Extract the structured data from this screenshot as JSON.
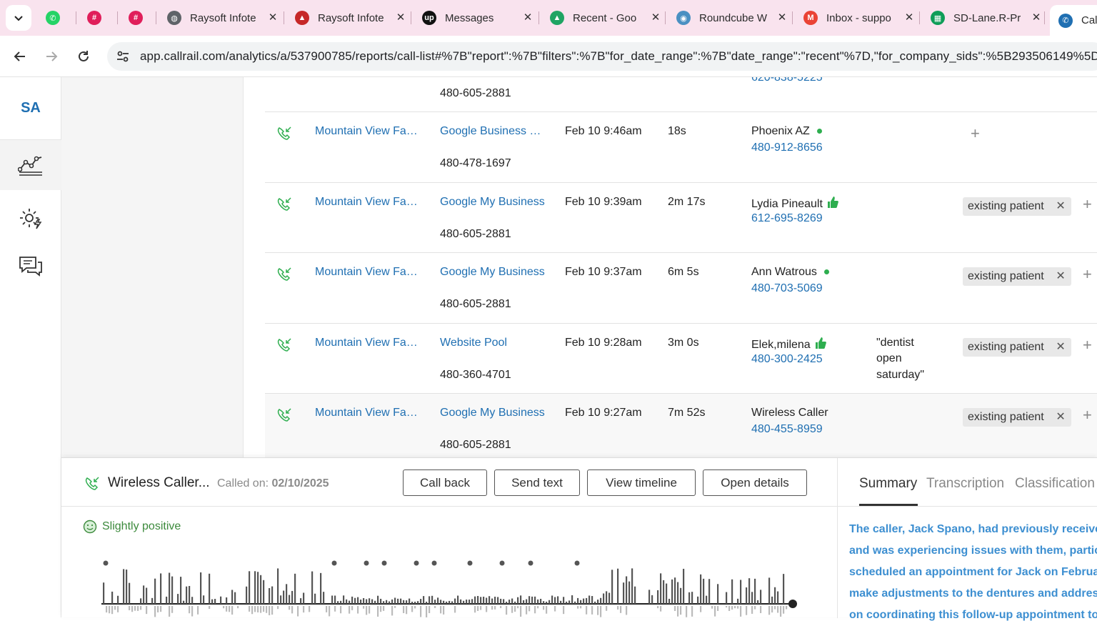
{
  "browser": {
    "tabs": [
      {
        "title": "",
        "icon": "whatsapp-icon",
        "color": "#25d366"
      },
      {
        "title": "",
        "icon": "slack-icon",
        "color": "#e01e5a"
      },
      {
        "title": "",
        "icon": "slack-icon",
        "color": "#e01e5a"
      },
      {
        "title": "Raysoft Infote",
        "icon": "globe-icon",
        "color": "#5f6368"
      },
      {
        "title": "Raysoft Infote",
        "icon": "cap-icon",
        "color": "#c62828"
      },
      {
        "title": "Messages",
        "icon": "upwork-icon",
        "color": "#111111"
      },
      {
        "title": "Recent - Goo",
        "icon": "drive-icon",
        "color": "#1fa463"
      },
      {
        "title": "Roundcube W",
        "icon": "roundcube-icon",
        "color": "#4a90c2"
      },
      {
        "title": "Inbox - suppo",
        "icon": "gmail-icon",
        "color": "#ea4335"
      },
      {
        "title": "SD-Lane.R-Pr",
        "icon": "sheets-icon",
        "color": "#0f9d58"
      },
      {
        "title": "Call",
        "icon": "callrail-icon",
        "color": "#1f6fb2"
      }
    ],
    "url": "app.callrail.com/analytics/a/537900785/reports/call-list#%7B\"report\":%7B\"filters\":%7B\"for_date_range\":%7B\"date_range\":\"recent\"%7D,\"for_company_sids\":%5B293506149%5D"
  },
  "sidebar": {
    "avatar": "SA",
    "icons": [
      "analytics-icon",
      "settings-bolt-icon",
      "chat-icon"
    ]
  },
  "calls": {
    "partial_row": {
      "tracking": "480-605-2881",
      "caller_phone": "620-838-5225"
    },
    "rows": [
      {
        "company": "Mountain View Fa…",
        "source": "Google Business …",
        "tracking": "480-478-1697",
        "date": "Feb 10 9:46am",
        "duration": "18s",
        "caller": "Phoenix AZ",
        "phone": "480-912-8656",
        "indicator": "dot",
        "keywords": "",
        "tag": ""
      },
      {
        "company": "Mountain View Fa…",
        "source": "Google My Business",
        "tracking": "480-605-2881",
        "date": "Feb 10 9:39am",
        "duration": "2m 17s",
        "caller": "Lydia Pineault",
        "phone": "612-695-8269",
        "indicator": "thumb",
        "keywords": "",
        "tag": "existing patient"
      },
      {
        "company": "Mountain View Fa…",
        "source": "Google My Business",
        "tracking": "480-605-2881",
        "date": "Feb 10 9:37am",
        "duration": "6m 5s",
        "caller": "Ann Watrous",
        "phone": "480-703-5069",
        "indicator": "dot",
        "keywords": "",
        "tag": "existing patient"
      },
      {
        "company": "Mountain View Fa…",
        "source": "Website Pool",
        "tracking": "480-360-4701",
        "date": "Feb 10 9:28am",
        "duration": "3m 0s",
        "caller": "Elek,milena",
        "phone": "480-300-2425",
        "indicator": "thumb",
        "keywords": [
          "\"dentist",
          "open",
          "saturday\""
        ],
        "tag": "existing patient"
      },
      {
        "company": "Mountain View Fa…",
        "source": "Google My Business",
        "tracking": "480-605-2881",
        "date": "Feb 10 9:27am",
        "duration": "7m 52s",
        "caller": "Wireless Caller",
        "phone": "480-455-8959",
        "indicator": "",
        "keywords": "",
        "tag": "existing patient"
      }
    ]
  },
  "detail": {
    "caller": "Wireless Caller...",
    "called_on_label": "Called on:",
    "called_on_date": "02/10/2025",
    "buttons": {
      "call_back": "Call back",
      "send_text": "Send text",
      "view_timeline": "View timeline",
      "open_details": "Open details"
    },
    "sentiment": "Slightly positive",
    "tabs": {
      "summary": "Summary",
      "transcription": "Transcription",
      "classification": "Classification"
    },
    "summary_lines": [
      "The caller, Jack Spano, had previously received",
      "and was experiencing issues with them, particu",
      "scheduled an appointment for Jack on Februar",
      "make adjustments to the dentures and addres",
      "on coordinating this follow-up appointment to"
    ]
  },
  "colors": {
    "link": "#1f6fb2",
    "positive": "#2eae4f",
    "summary": "#3d8fd1",
    "tabbar": "#f9e3ee"
  }
}
